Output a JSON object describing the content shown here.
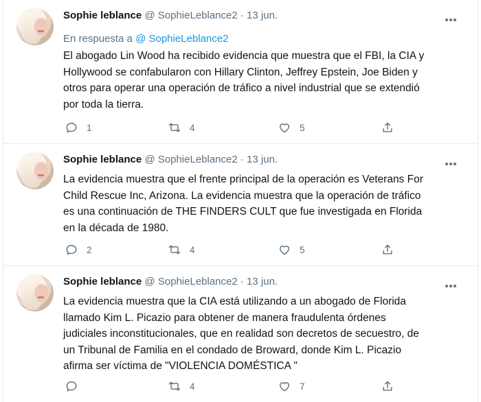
{
  "tweets": [
    {
      "name": "Sophie leblance",
      "handle": "@ SophieLeblance2",
      "date": "· 13 jun.",
      "reply_prefix": "En respuesta a",
      "reply_handle": "@ SophieLeblance2",
      "text": "El abogado Lin Wood ha recibido evidencia que muestra que el FBI, la CIA y\nHollywood se confabularon con Hillary Clinton, Jeffrey Epstein, Joe Biden y\notros para operar una operación de tráfico a nivel industrial que se extendió\npor toda la tierra.",
      "replies": "1",
      "retweets": "4",
      "likes": "5"
    },
    {
      "name": "Sophie leblance",
      "handle": "@ SophieLeblance2",
      "date": "· 13 jun.",
      "text": "La evidencia muestra que el frente principal de la operación es Veterans For\nChild Rescue Inc, Arizona. La evidencia muestra que la operación de tráfico\nes una continuación de THE FINDERS CULT que fue investigada en Florida\nen la década de 1980.",
      "replies": "2",
      "retweets": "4",
      "likes": "5"
    },
    {
      "name": "Sophie leblance",
      "handle": "@ SophieLeblance2",
      "date": "· 13 jun.",
      "text": "La evidencia muestra que la CIA está utilizando a un abogado de Florida\nllamado Kim L. Picazio para obtener de manera fraudulenta órdenes\njudiciales inconstitucionales, que en realidad son decretos de secuestro, de\nun Tribunal de Familia en el condado de Broward, donde Kim L. Picazio\nafirma ser víctima de \"VIOLENCIA DOMÉSTICA \"",
      "replies": "",
      "retweets": "4",
      "likes": "7"
    }
  ],
  "icons": {
    "reply": "speech-bubble-icon",
    "retweet": "retweet-arrows-icon",
    "like": "heart-icon",
    "share": "share-upload-icon",
    "more": "more-dots-icon"
  },
  "colors": {
    "link": "#1b95e0",
    "secondary_text": "#5b7083",
    "border": "#e6ecf0"
  }
}
